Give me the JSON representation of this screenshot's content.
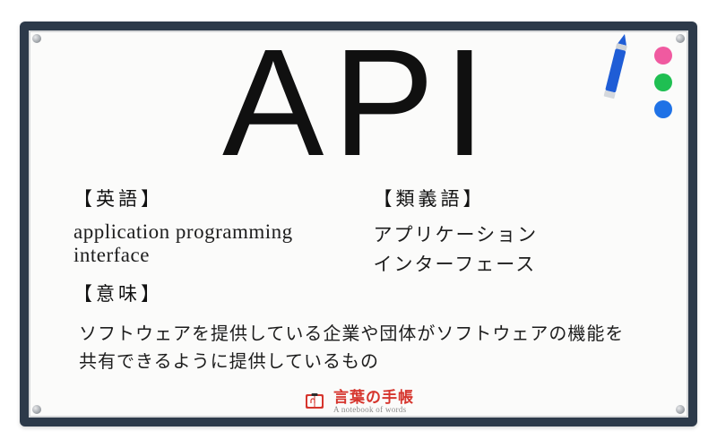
{
  "headline": "API",
  "left": {
    "english_label": "【英語】",
    "english_body": "application programming interface",
    "meaning_label": "【意味】"
  },
  "right": {
    "syn_label": "【類義語】",
    "syn_line1": "アプリケーション",
    "syn_line2": "インターフェース"
  },
  "meaning_line1": "ソフトウェアを提供している企業や団体がソフトウェアの機能を",
  "meaning_line2": "共有できるように提供しているもの",
  "logo": {
    "jp": "言葉の手帳",
    "en": "A notebook of words"
  },
  "colors": {
    "frame": "#2d3a4a",
    "accent_red": "#d6352d",
    "dot_pink": "#f05aa0",
    "dot_green": "#1fbf52",
    "dot_blue": "#1f72e6",
    "marker_blue": "#1f5dd6"
  }
}
